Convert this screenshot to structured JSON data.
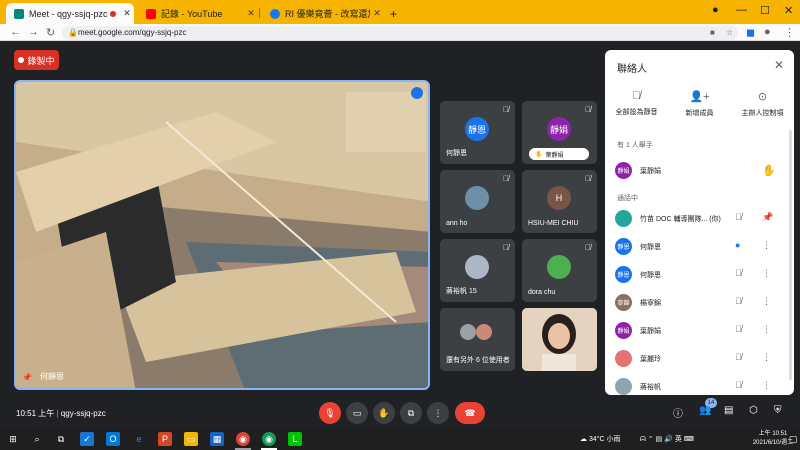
{
  "browser": {
    "tabs": [
      {
        "title": "Meet - qgy-ssjq-pzc",
        "favicon_color": "#00897b",
        "recording_dot": true
      },
      {
        "title": "記錄 - YouTube",
        "favicon_color": "#ff0000"
      },
      {
        "title": "RI 優樂竟薈 - 改寫還加主還會議",
        "favicon_color": "#1877f2"
      }
    ],
    "new_tab": "+",
    "url": "meet.google.com/qgy-ssjq-pzc"
  },
  "meet": {
    "recording_label": "錄製中",
    "main_speaker_name": "何靜恩",
    "tiles": [
      {
        "name": "何靜恩",
        "avatar_text": "靜恩",
        "avatar_color": "#1a73e8"
      },
      {
        "name": "葉靜娟",
        "avatar_text": "靜娟",
        "avatar_color": "#8e24aa",
        "hand_raised": true
      },
      {
        "name": "ann ho",
        "avatar_text": "",
        "avatar_color": "#6d8fa8"
      },
      {
        "name": "HSIU-MEI CHIU",
        "avatar_text": "H",
        "avatar_color": "#795548"
      },
      {
        "name": "蔣裕帆 15",
        "avatar_text": "",
        "avatar_color": "#aab7c4"
      },
      {
        "name": "dora chu",
        "avatar_text": "",
        "avatar_color": "#4caf50"
      },
      {
        "name": "還有另外 6 位使用者",
        "avatar_text": "",
        "avatar_color": "#9aa0a6"
      },
      {
        "name": "",
        "avatar_text": "",
        "avatar_color": "#c9a184",
        "self_view": true
      }
    ],
    "time": "10:51 上午",
    "meeting_code": "qgy-ssjq-pzc",
    "people_count": "14"
  },
  "panel": {
    "title": "聯絡人",
    "actions": [
      "全部設為靜音",
      "新增成員",
      "主辦人控制項"
    ],
    "raised_hand_label": "有 1 人舉手",
    "raised_hand_person": {
      "name": "葉靜娟",
      "avatar_text": "靜娟",
      "avatar_color": "#8e24aa"
    },
    "in_call_label": "通話中",
    "people": [
      {
        "name": "竹苗 DOC 輔導團隊... (你)",
        "avatar_text": "",
        "avatar_color": "#26a69a"
      },
      {
        "name": "何靜恩",
        "avatar_text": "靜恩",
        "avatar_color": "#1a73e8"
      },
      {
        "name": "何靜恩",
        "avatar_text": "靜恩",
        "avatar_color": "#1a73e8"
      },
      {
        "name": "楊寧錦",
        "avatar_text": "寧錦",
        "avatar_color": "#8d6e63"
      },
      {
        "name": "葉靜娟",
        "avatar_text": "靜娟",
        "avatar_color": "#8e24aa"
      },
      {
        "name": "葉麗玲",
        "avatar_text": "",
        "avatar_color": "#e57373"
      },
      {
        "name": "蔣裕帆",
        "avatar_text": "",
        "avatar_color": "#90a4ae"
      }
    ]
  },
  "taskbar": {
    "weather": "34°C 小雨",
    "ime": "英",
    "time": "上午 10:51",
    "date": "2021/6/10/週二"
  }
}
